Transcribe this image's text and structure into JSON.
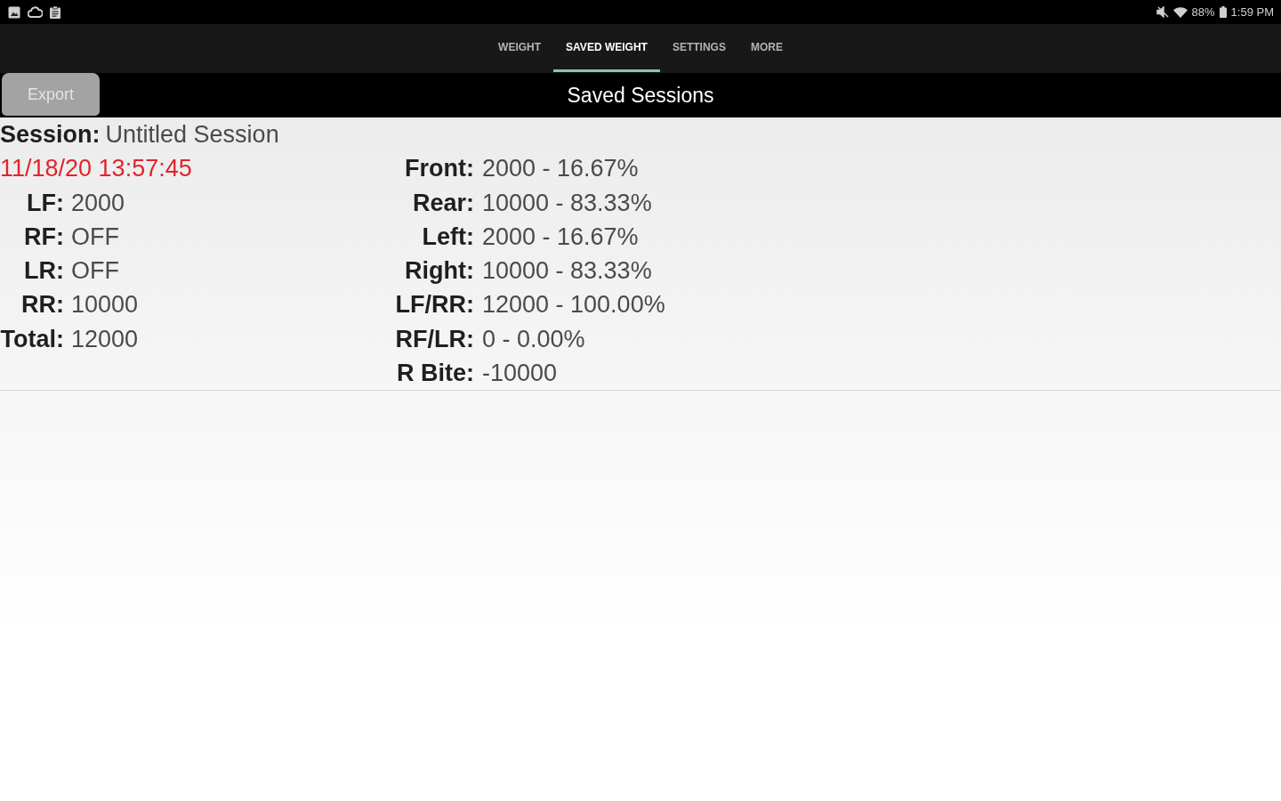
{
  "status_bar": {
    "battery": "88%",
    "time": "1:59 PM"
  },
  "tabs": [
    {
      "label": "WEIGHT",
      "selected": false
    },
    {
      "label": "SAVED WEIGHT",
      "selected": true
    },
    {
      "label": "SETTINGS",
      "selected": false
    },
    {
      "label": "MORE",
      "selected": false
    }
  ],
  "header": {
    "export_button": "Export",
    "title": "Saved Sessions"
  },
  "session": {
    "label": "Session:",
    "name": "Untitled Session",
    "timestamp": "11/18/20 13:57:45",
    "wheels": [
      {
        "label": "LF:",
        "value": "2000"
      },
      {
        "label": "RF:",
        "value": "OFF"
      },
      {
        "label": "LR:",
        "value": "OFF"
      },
      {
        "label": "RR:",
        "value": "10000"
      },
      {
        "label": "Total:",
        "value": "12000"
      }
    ],
    "distribution": [
      {
        "label": "Front:",
        "value": "2000 - 16.67%"
      },
      {
        "label": "Rear:",
        "value": "10000 - 83.33%"
      },
      {
        "label": "Left:",
        "value": "2000 - 16.67%"
      },
      {
        "label": "Right:",
        "value": "10000 - 83.33%"
      },
      {
        "label": "LF/RR:",
        "value": "12000 - 100.00%"
      },
      {
        "label": "RF/LR:",
        "value": "0 - 0.00%"
      },
      {
        "label": "R Bite:",
        "value": "-10000"
      }
    ]
  }
}
